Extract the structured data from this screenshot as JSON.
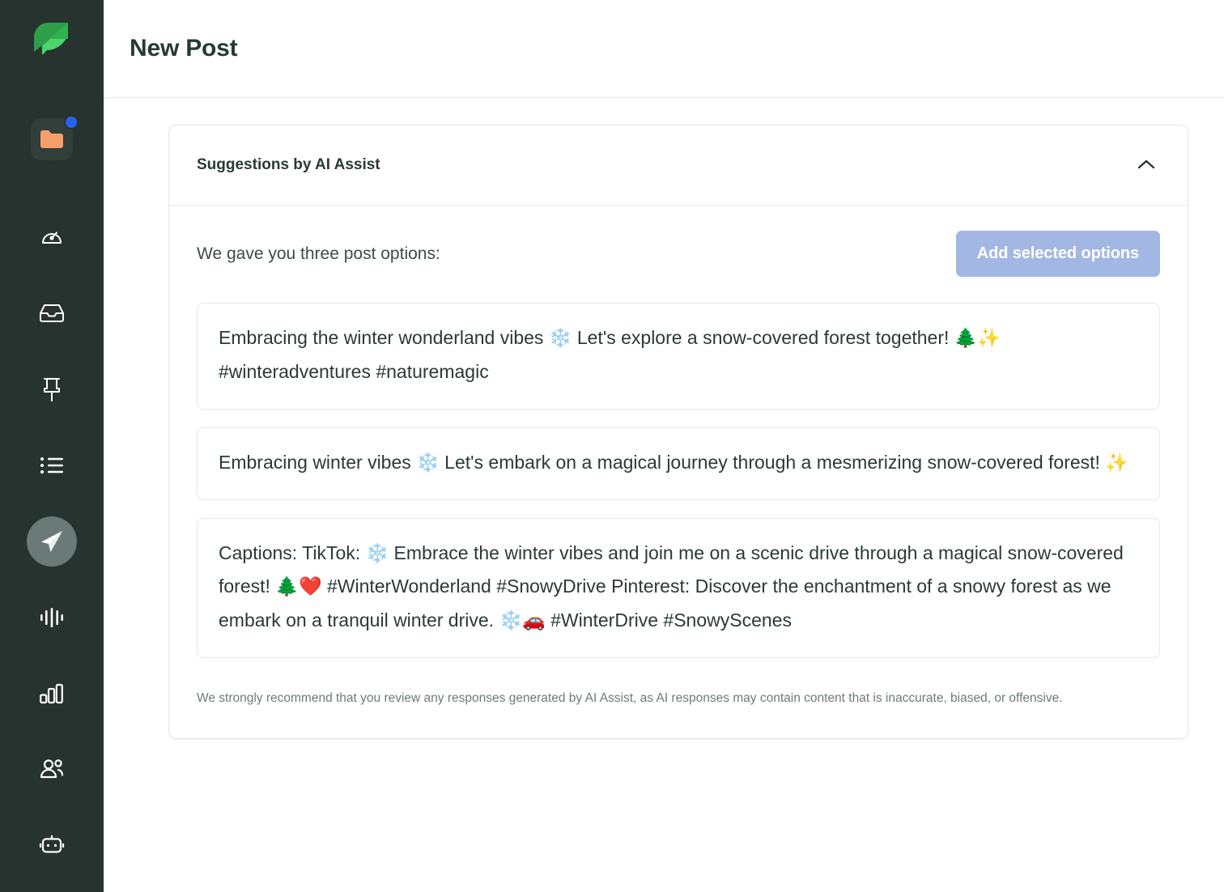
{
  "brand": {
    "logo_name": "sprout-leaf-logo",
    "sidebar_bg": "#26332f",
    "accent_green": "#3cbb5a",
    "badge_blue": "#2563eb",
    "folder_orange": "#f79f6a"
  },
  "sidebar": {
    "items": [
      {
        "icon": "folder-icon",
        "label": "Assets",
        "badge": true,
        "active": false
      },
      {
        "icon": "speedometer-icon",
        "label": "Dashboard",
        "badge": false,
        "active": false
      },
      {
        "icon": "inbox-icon",
        "label": "Smart Inbox",
        "badge": false,
        "active": false
      },
      {
        "icon": "pin-icon",
        "label": "Reviews",
        "badge": false,
        "active": false
      },
      {
        "icon": "list-icon",
        "label": "Tasks",
        "badge": false,
        "active": false
      },
      {
        "icon": "paper-plane-icon",
        "label": "Publishing",
        "badge": false,
        "active": true
      },
      {
        "icon": "waveform-icon",
        "label": "Listening",
        "badge": false,
        "active": false
      },
      {
        "icon": "bar-chart-icon",
        "label": "Reports",
        "badge": false,
        "active": false
      },
      {
        "icon": "people-icon",
        "label": "Audience",
        "badge": false,
        "active": false
      },
      {
        "icon": "robot-icon",
        "label": "Bots",
        "badge": false,
        "active": false
      }
    ]
  },
  "header": {
    "title": "New Post"
  },
  "ai_card": {
    "title": "Suggestions by AI Assist",
    "collapse_icon": "chevron-up-icon",
    "options_label": "We gave you three post options:",
    "add_button_label": "Add selected options",
    "suggestions": [
      "Embracing the winter wonderland vibes ❄️ Let's explore a snow-covered forest together! 🌲✨ #winteradventures #naturemagic",
      "Embracing winter vibes ❄️ Let's embark on a magical journey through a mesmerizing snow-covered forest! ✨",
      "Captions: TikTok: ❄️ Embrace the winter vibes and join me on a scenic drive through a magical snow-covered forest! 🌲❤️ #WinterWonderland #SnowyDrive Pinterest: Discover the enchantment of a snowy forest as we embark on a tranquil winter drive. ❄️🚗 #WinterDrive #SnowyScenes"
    ],
    "disclaimer": "We strongly recommend that you review any responses generated by AI Assist, as AI responses may contain content that is inaccurate, biased, or offensive."
  }
}
